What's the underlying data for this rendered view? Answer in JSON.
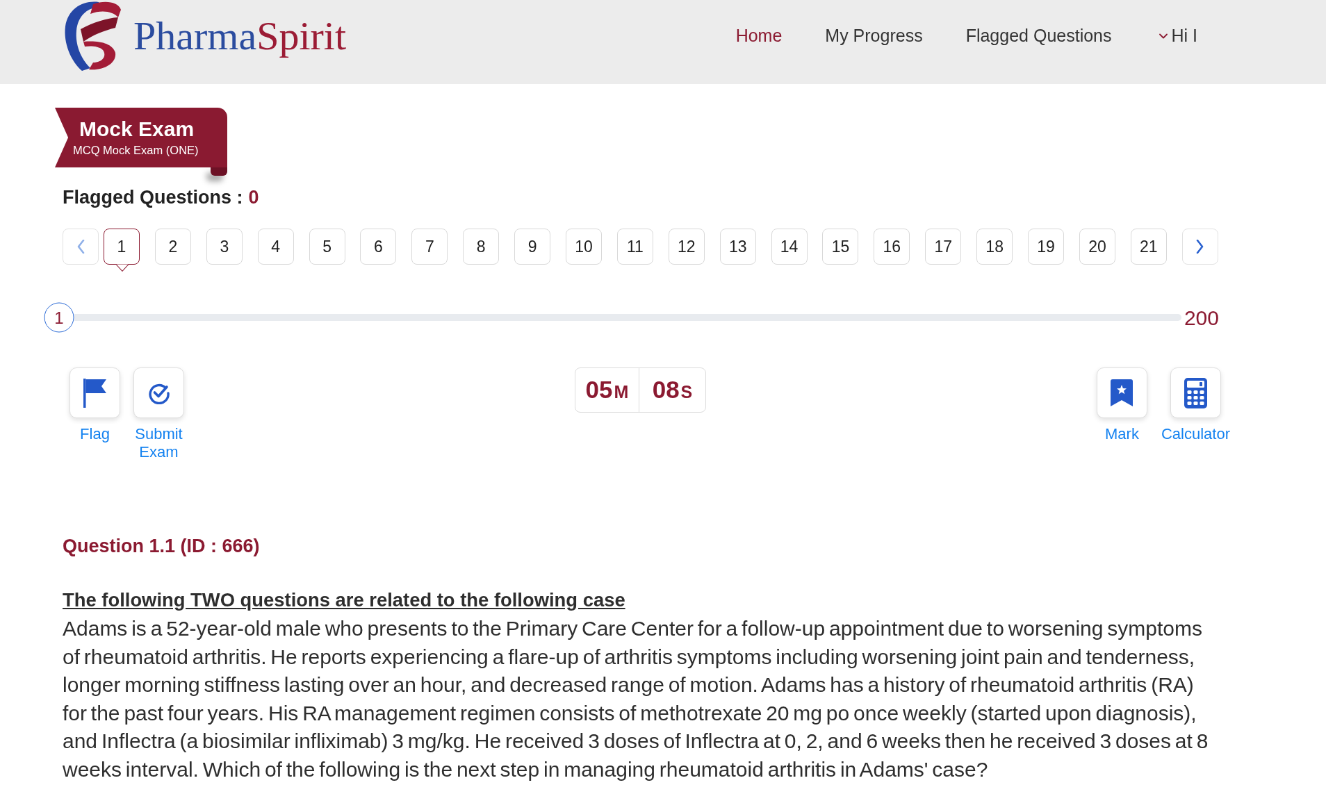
{
  "header": {
    "logo": {
      "name_parts": [
        "Pharma",
        "Spirit"
      ]
    },
    "nav": [
      {
        "label": "Home",
        "selected": true
      },
      {
        "label": "My Progress",
        "selected": false
      },
      {
        "label": "Flagged Questions",
        "selected": false
      }
    ],
    "user_menu": {
      "label": "Hi I"
    }
  },
  "exam_banner": {
    "title": "Mock Exam",
    "subtitle": "MCQ Mock Exam (ONE)"
  },
  "flagged": {
    "label": "Flagged Questions :",
    "count": "0"
  },
  "pagination": {
    "previous": {
      "disabled": true
    },
    "pages": [
      {
        "label": "1",
        "selected": true
      },
      {
        "label": "2",
        "selected": false
      },
      {
        "label": "3",
        "selected": false
      },
      {
        "label": "4",
        "selected": false
      },
      {
        "label": "5",
        "selected": false
      },
      {
        "label": "6",
        "selected": false
      },
      {
        "label": "7",
        "selected": false
      },
      {
        "label": "8",
        "selected": false
      },
      {
        "label": "9",
        "selected": false
      },
      {
        "label": "10",
        "selected": false
      },
      {
        "label": "11",
        "selected": false
      },
      {
        "label": "12",
        "selected": false
      },
      {
        "label": "13",
        "selected": false
      },
      {
        "label": "14",
        "selected": false
      },
      {
        "label": "15",
        "selected": false
      },
      {
        "label": "16",
        "selected": false
      },
      {
        "label": "17",
        "selected": false
      },
      {
        "label": "18",
        "selected": false
      },
      {
        "label": "19",
        "selected": false
      },
      {
        "label": "20",
        "selected": false
      },
      {
        "label": "21",
        "selected": false
      }
    ],
    "next": {
      "disabled": false
    }
  },
  "progress": {
    "current": "1",
    "total": "200",
    "level": 0
  },
  "tools_left": [
    {
      "kind": "flag",
      "label": "Flag"
    },
    {
      "kind": "submit",
      "label": "Submit Exam"
    }
  ],
  "timer": [
    {
      "value": "05",
      "unit": "M"
    },
    {
      "value": "08",
      "unit": "S"
    }
  ],
  "tools_right": [
    {
      "kind": "mark",
      "label": "Mark"
    },
    {
      "kind": "calculator",
      "label": "Calculator"
    }
  ],
  "question": {
    "title": "Question 1.1 (ID : 666)",
    "case_heading": "The following TWO questions are related to the following case",
    "text": "Adams is a 52-year-old male who presents to the Primary Care Center for a follow-up appointment due to worsening symptoms of rheumatoid arthritis. He reports experiencing a flare-up of arthritis symptoms including worsening joint pain and tenderness, longer morning stiffness lasting over an hour, and decreased range of motion. Adams has a history of rheumatoid arthritis (RA) for the past four years. His RA management regimen consists of methotrexate 20 mg po once weekly (started upon diagnosis), and Inflectra (a biosimilar infliximab) 3 mg/kg. He received 3 doses of Inflectra at 0, 2, and 6 weeks then he received 3 doses at 8 weeks interval. Which of the following is the next step in managing rheumatoid arthritis in Adams' case?"
  }
}
